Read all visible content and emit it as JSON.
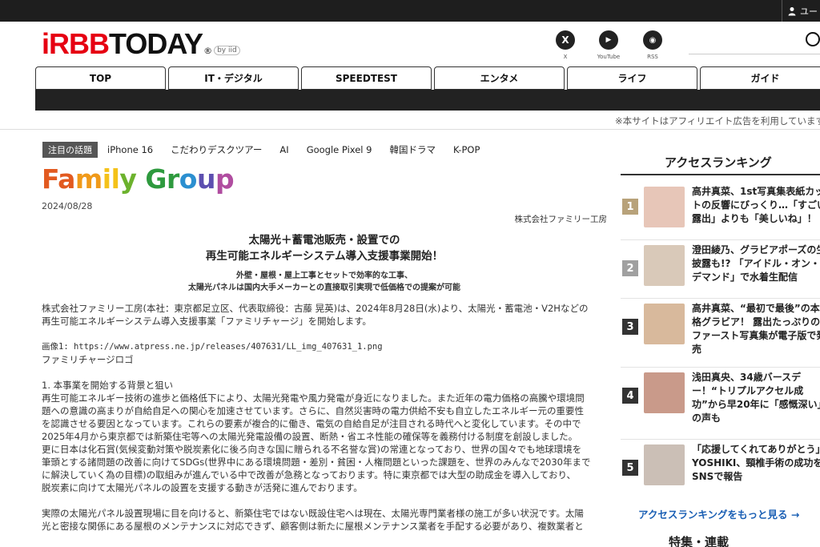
{
  "topbar": {
    "user_label": "ユー",
    "user_icon": "user-icon"
  },
  "logo": {
    "prefix": "i",
    "brand_red": "RBB",
    "brand": "TODAY",
    "reg": "®",
    "by": "by iid"
  },
  "social": [
    {
      "name": "x",
      "glyph": "X",
      "label": "X"
    },
    {
      "name": "youtube",
      "glyph": "▶",
      "label": "YouTube"
    },
    {
      "name": "rss",
      "glyph": "◉",
      "label": "RSS"
    }
  ],
  "nav": [
    "TOP",
    "IT・デジタル",
    "SPEEDTEST",
    "エンタメ",
    "ライフ",
    "ガイド"
  ],
  "disclaimer": "※本サイトはアフィリエイト広告を利用しています",
  "topics": {
    "badge": "注目の話題",
    "items": [
      "iPhone 16",
      "こだわりデスクツアー",
      "AI",
      "Google Pixel 9",
      "韓国ドラマ",
      "K-POP"
    ]
  },
  "article": {
    "logo_parts": [
      "Fa",
      "m",
      "il",
      "y ",
      "Gr",
      "o",
      "u",
      "p"
    ],
    "date": "2024/08/28",
    "company": "株式会社ファミリー工房",
    "headline_1": "太陽光＋蓄電池販売・設置での",
    "headline_2": "再生可能エネルギーシステム導入支援事業開始！",
    "subhead_1": "外壁・屋根・屋上工事とセットで効率的な工事、",
    "subhead_2": "太陽光パネルは国内大手メーカーとの直接取引実現で低価格での提案が可能",
    "p1_1": "株式会社ファミリー工房(本社：東京都足立区、代表取締役：古藤 晃英)は、2024年8月28日(水)より、太陽光・蓄電池・V2Hなどの",
    "p1_2": "再生可能エネルギーシステム導入支援事業「ファミリチャージ」を開始します。",
    "img_line": "画像1: https://www.atpress.ne.jp/releases/407631/LL_img_407631_1.png",
    "img_caption": "ファミリチャージロゴ",
    "sec1_title": "1. 本事業を開始する背景と狙い",
    "s1": "再生可能エネルギー技術の進歩と価格低下により、太陽光発電や風力発電が身近になりました。また近年の電力価格の高騰や環境問",
    "s2": "題への意識の高まりが自給自足への関心を加速させています。さらに、自然災害時の電力供給不安も自立したエネルギー元の重要性",
    "s3": "を認識させる要因となっています。これらの要素が複合的に働き、電気の自給自足が注目される時代へと変化しています。その中で",
    "s4": "2025年4月から東京都では新築住宅等への太陽光発電設備の設置、断熱・省エネ性能の確保等を義務付ける制度を創設しました。",
    "s5": "更に日本は化石賞(気候変動対策や脱炭素化に後ろ向きな国に贈られる不名誉な賞)の常連となっており、世界の国々でも地球環境を",
    "s6": "筆頭とする諸問題の改善に向けてSDGs(世界中にある環境問題・差別・貧困・人権問題といった課題を、世界のみんなで2030年まで",
    "s7": "に解決していく為の目標)の取組みが進んでいる中で改善が急務となっております。特に東京都では大型の助成金を導入しており、",
    "s8": "脱炭素に向けて太陽光パネルの設置を支援する動きが活発に進んでおります。",
    "t1": "実際の太陽光パネル設置現場に目を向けると、新築住宅ではない既設住宅へは現在、太陽光専門業者様の施工が多い状況です。太陽",
    "t2": "光と密接な関係にある屋根のメンテナンスに対応できず、顧客側は新たに屋根メンテナンス業者を手配する必要があり、複数業者と"
  },
  "sidebar": {
    "ranking_title": "アクセスランキング",
    "items": [
      {
        "rank": "1",
        "l1": "高井真菜、1st写真集表紙カッ",
        "l2": "トの反響にびっくり…「すごい",
        "l3": "露出」よりも「美しいね」！",
        "l4": ""
      },
      {
        "rank": "2",
        "l1": "澄田綾乃、グラビアポーズの生",
        "l2": "披露も!? 「アイドル・オン・",
        "l3": "デマンド」で水着生配信",
        "l4": ""
      },
      {
        "rank": "3",
        "l1": "高井真菜、“最初で最後”の本",
        "l2": "格グラビア！ 露出たっぷりの",
        "l3": "ファースト写真集が電子版で発",
        "l4": "売"
      },
      {
        "rank": "4",
        "l1": "浅田真央、34歳バースデ",
        "l2": "ー！“トリプルアクセル成",
        "l3": "功”から早20年に「感慨深い」",
        "l4": "の声も"
      },
      {
        "rank": "5",
        "l1": "「応援してくれてありがとう」",
        "l2": "YOSHIKI、頸椎手術の成功を",
        "l3": "SNSで報告",
        "l4": ""
      }
    ],
    "more_link": "アクセスランキングをもっと見る →",
    "feature_title": "特集・連載"
  },
  "colors": {
    "rank_badge": [
      "#b8a27a",
      "#a0a0a0",
      "#333333",
      "#333333",
      "#333333"
    ],
    "thumbs": [
      "#e7c6b8",
      "#d9c9b9",
      "#d8b99c",
      "#c99a8a",
      "#cbbfb6"
    ],
    "accent_red": "#e60012",
    "link_blue": "#1a5fb4"
  }
}
